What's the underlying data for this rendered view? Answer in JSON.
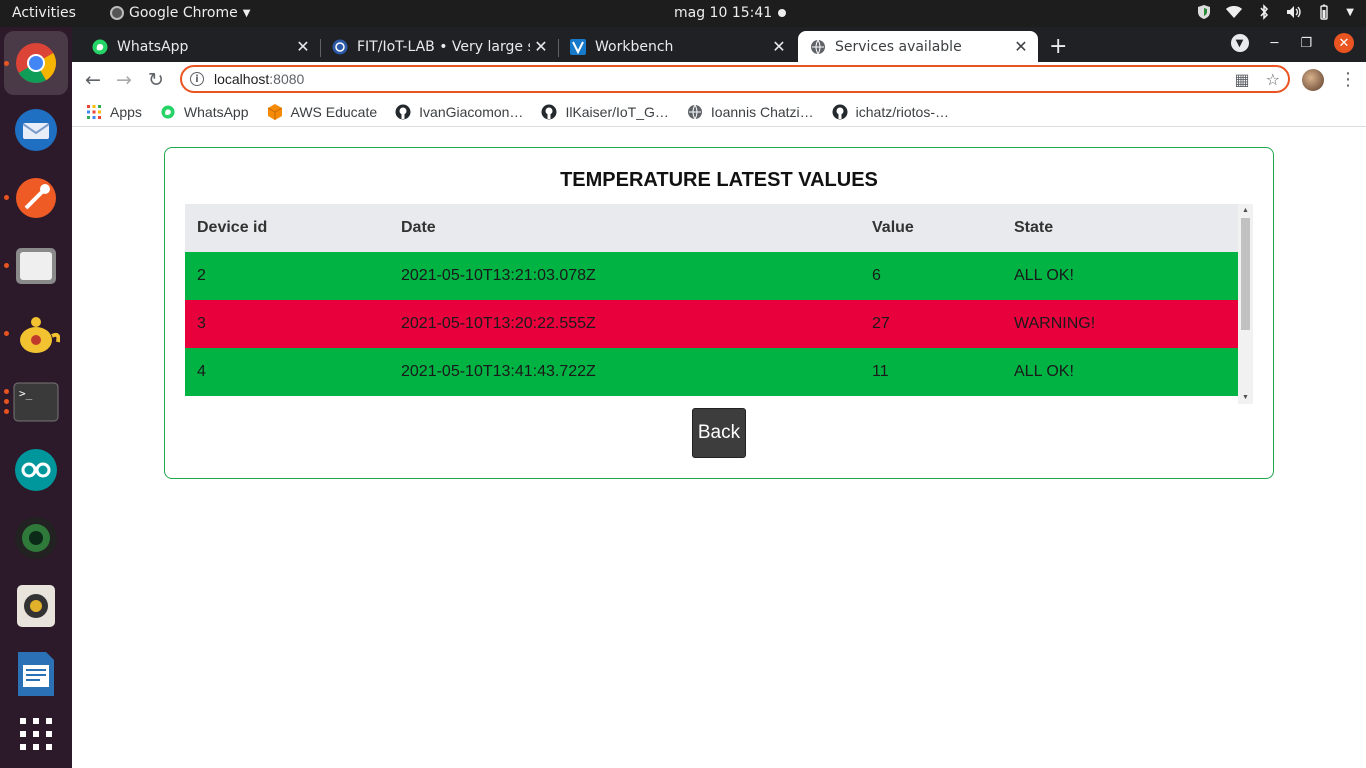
{
  "topbar": {
    "activities": "Activities",
    "app_name": "Google Chrome",
    "datetime": "mag 10  15:41"
  },
  "tabs": [
    {
      "title": "WhatsApp"
    },
    {
      "title": "FIT/IoT-LAB • Very large sc"
    },
    {
      "title": "Workbench"
    },
    {
      "title": "Services available"
    }
  ],
  "omnibox": {
    "host": "localhost",
    "port": ":8080"
  },
  "bookmarks": [
    {
      "label": "Apps"
    },
    {
      "label": "WhatsApp"
    },
    {
      "label": "AWS Educate"
    },
    {
      "label": "IvanGiacomon…"
    },
    {
      "label": "IlKaiser/IoT_G…"
    },
    {
      "label": "Ioannis Chatzi…"
    },
    {
      "label": "ichatz/riotos-…"
    }
  ],
  "page": {
    "title": "TEMPERATURE LATEST VALUES",
    "columns": [
      "Device id",
      "Date",
      "Value",
      "State"
    ],
    "rows": [
      {
        "device_id": "2",
        "date": "2021-05-10T13:21:03.078Z",
        "value": "6",
        "state": "ALL OK!"
      },
      {
        "device_id": "3",
        "date": "2021-05-10T13:20:22.555Z",
        "value": "27",
        "state": "WARNING!"
      },
      {
        "device_id": "4",
        "date": "2021-05-10T13:41:43.722Z",
        "value": "11",
        "state": "ALL OK!"
      }
    ],
    "back_label": "Back"
  },
  "colors": {
    "ok": "#00b343",
    "warning": "#e8003d",
    "card_border": "#1fa84f",
    "accent": "#e95420"
  }
}
